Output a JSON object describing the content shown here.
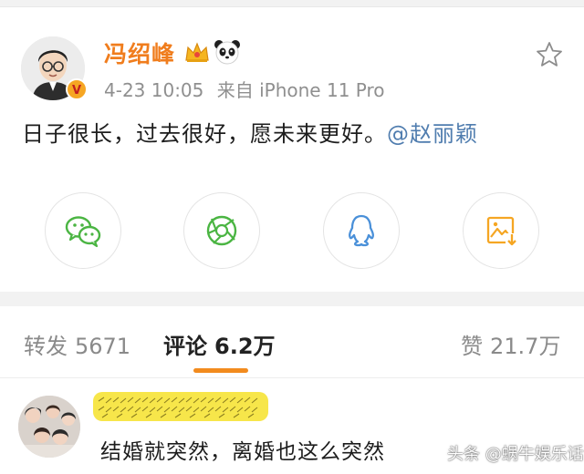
{
  "post": {
    "username": "冯绍峰",
    "date": "4-23 10:05",
    "source": "来自 iPhone 11 Pro",
    "text": "日子很长，过去很好，愿未来更好。",
    "mention": "@赵丽颖"
  },
  "share": {
    "icons": [
      "wechat-icon",
      "moments-icon",
      "qq-icon",
      "save-image-icon"
    ]
  },
  "tabs": {
    "repost_label": "转发",
    "repost_count": "5671",
    "comment_label": "评论",
    "comment_count": "6.2万",
    "like_label": "赞",
    "like_count": "21.7万"
  },
  "comment": {
    "text": "结婚就突然，离婚也这么突然"
  },
  "watermark": "头条 @蜗牛娱乐话",
  "colors": {
    "accent": "#f07d1d",
    "link": "#507daf",
    "share_green": "#4bb543",
    "share_blue": "#4a90d9",
    "share_orange": "#f5a623"
  }
}
